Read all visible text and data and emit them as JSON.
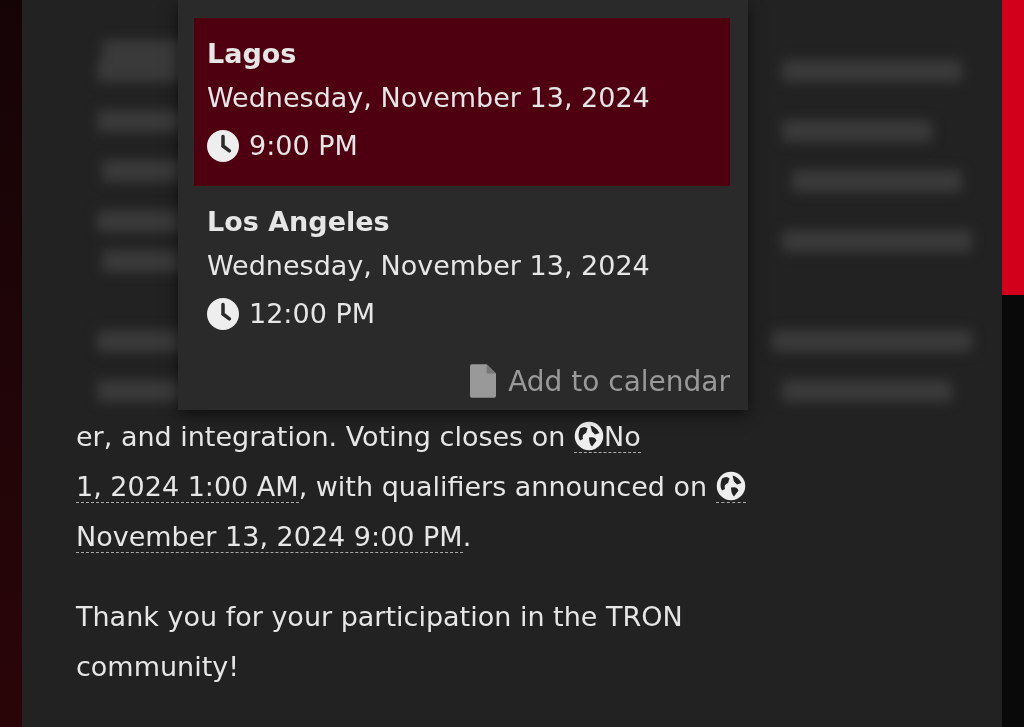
{
  "popup": {
    "locations": [
      {
        "city": "Lagos",
        "date": "Wednesday, November 13, 2024",
        "time": "9:00 PM",
        "selected": true
      },
      {
        "city": "Los Angeles",
        "date": "Wednesday, November 13, 2024",
        "time": "12:00 PM",
        "selected": false
      }
    ],
    "add_to_calendar": "Add to calendar"
  },
  "post": {
    "paragraphs": [
      {
        "lines": [
          [
            {
              "kind": "text",
              "text": "er, and integration. Voting closes on "
            },
            {
              "kind": "date",
              "text": "No"
            }
          ],
          [
            {
              "kind": "date_tail",
              "text": "1, 2024 1:00 AM"
            },
            {
              "kind": "text",
              "text": ", with qualifiers announced on "
            },
            {
              "kind": "date"
            }
          ],
          [
            {
              "kind": "date_tail",
              "text": "November 13, 2024 9:00 PM"
            },
            {
              "kind": "text",
              "text": "."
            }
          ]
        ]
      },
      {
        "lines": [
          [
            {
              "kind": "text",
              "text": "Thank you for your participation in the TRON"
            }
          ],
          [
            {
              "kind": "text",
              "text": "community!"
            }
          ]
        ]
      }
    ]
  }
}
